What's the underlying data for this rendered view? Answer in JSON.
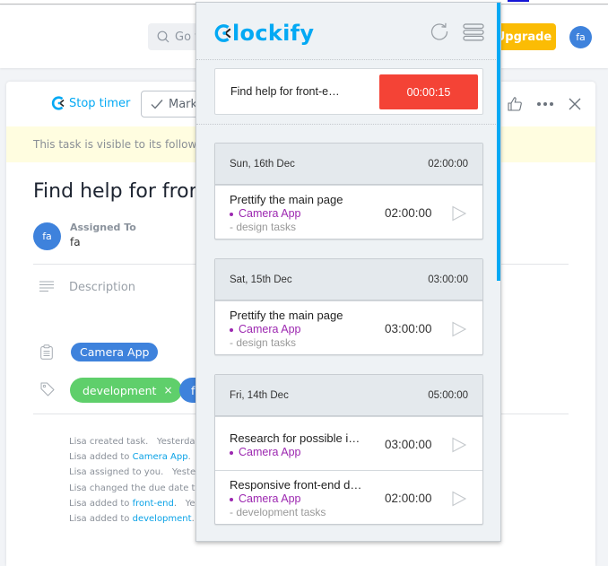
{
  "background_app": {
    "search": {
      "placeholder": "Go to...",
      "visible_text": "Go t"
    },
    "upgrade_label": "Upgrade",
    "user_avatar_initials": "fa",
    "task_card": {
      "stop_timer_label": "Stop timer",
      "mark_button_label": "Mark",
      "notice_text": "This task is visible to its followers",
      "title": "Find help for front-end",
      "assigned_to_label": "Assigned To",
      "assignee_initials": "fa",
      "assignee_name": "fa",
      "description_placeholder": "Description",
      "project_pill": "Camera App",
      "tags": [
        {
          "label": "development",
          "remove": "×",
          "color": "#5fcf6b"
        },
        {
          "label": "f",
          "color": "#3e82dc"
        }
      ],
      "activity": [
        {
          "actor": "Lisa",
          "text": " created task.",
          "link": "",
          "suffix": "",
          "time": "Yesterday"
        },
        {
          "actor": "Lisa",
          "text": " added to ",
          "link": "Camera App",
          "suffix": ".",
          "time": "Y"
        },
        {
          "actor": "Lisa",
          "text": " assigned to you.",
          "link": "",
          "suffix": "",
          "time": "Yesterd"
        },
        {
          "actor": "Lisa",
          "text": " changed the due date to",
          "link": "",
          "suffix": "",
          "time": ""
        },
        {
          "actor": "Lisa",
          "text": " added to ",
          "link": "front-end",
          "suffix": ".",
          "time": "Yes"
        },
        {
          "actor": "Lisa",
          "text": " added to ",
          "link": "development",
          "suffix": ".",
          "time": ""
        }
      ]
    }
  },
  "popup": {
    "logo_text": "lockify",
    "current_timer": {
      "description": "Find help for front-e…",
      "elapsed": "00:00:15",
      "button_color": "#f44336"
    },
    "days": [
      {
        "date": "Sun, 16th Dec",
        "total": "02:00:00",
        "entries": [
          {
            "description": "Prettify the main page",
            "project": "Camera App",
            "task": "- design tasks",
            "duration": "02:00:00"
          }
        ]
      },
      {
        "date": "Sat, 15th Dec",
        "total": "03:00:00",
        "entries": [
          {
            "description": "Prettify the main page",
            "project": "Camera App",
            "task": "- design tasks",
            "duration": "03:00:00"
          }
        ]
      },
      {
        "date": "Fri, 14th Dec",
        "total": "05:00:00",
        "entries": [
          {
            "description": "Research for possible i…",
            "project": "Camera App",
            "task": "",
            "duration": "03:00:00"
          },
          {
            "description": "Responsive front-end d…",
            "project": "Camera App",
            "task": "- development tasks",
            "duration": "02:00:00"
          }
        ]
      }
    ],
    "colors": {
      "brand": "#03a9f4",
      "project": "#9c27b0"
    }
  }
}
